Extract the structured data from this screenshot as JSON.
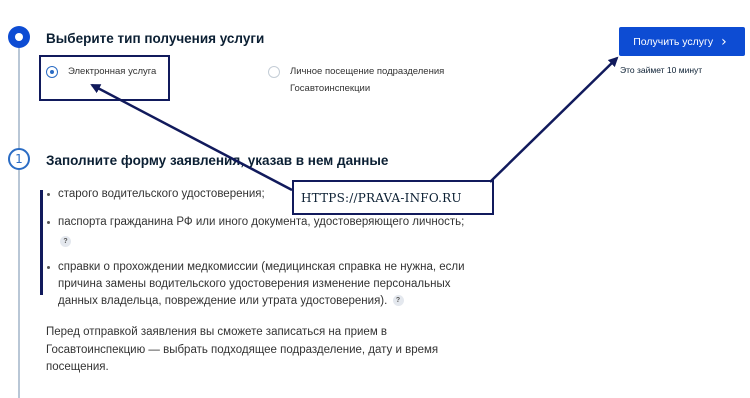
{
  "step1": {
    "title": "Выберите тип получения услуги",
    "options": [
      {
        "label": "Электронная услуга",
        "selected": true
      },
      {
        "label": "Личное посещение подразделения Госавтоинспекции",
        "selected": false
      }
    ]
  },
  "action": {
    "button_label": "Получить услугу",
    "time_note": "Это займет 10 минут"
  },
  "step2": {
    "number": "1",
    "title": "Заполните форму заявления, указав в нем данные",
    "bullets": [
      "старого водительского удостоверения;",
      "паспорта гражданина РФ или иного документа, удостоверяющего личность;",
      "справки о прохождении медкомиссии (медицинская справка не нужна, если причина замены водительского удостоверения изменение персональных данных владельца, повреждение или утрата удостоверения)."
    ],
    "help_glyph": "?",
    "paragraph": "Перед отправкой заявления вы сможете записаться на прием в Госавтоинспекцию — выбрать подходящее подразделение, дату и время посещения."
  },
  "watermark": "HTTPS://PRAVA-INFO.RU",
  "icons": {
    "chevron": "chevron-right-icon",
    "step_current": "current-step-icon",
    "help": "question-icon"
  },
  "colors": {
    "primary": "#0d4cd3",
    "annotation": "#111a5c",
    "timeline": "#b9c7d6"
  }
}
